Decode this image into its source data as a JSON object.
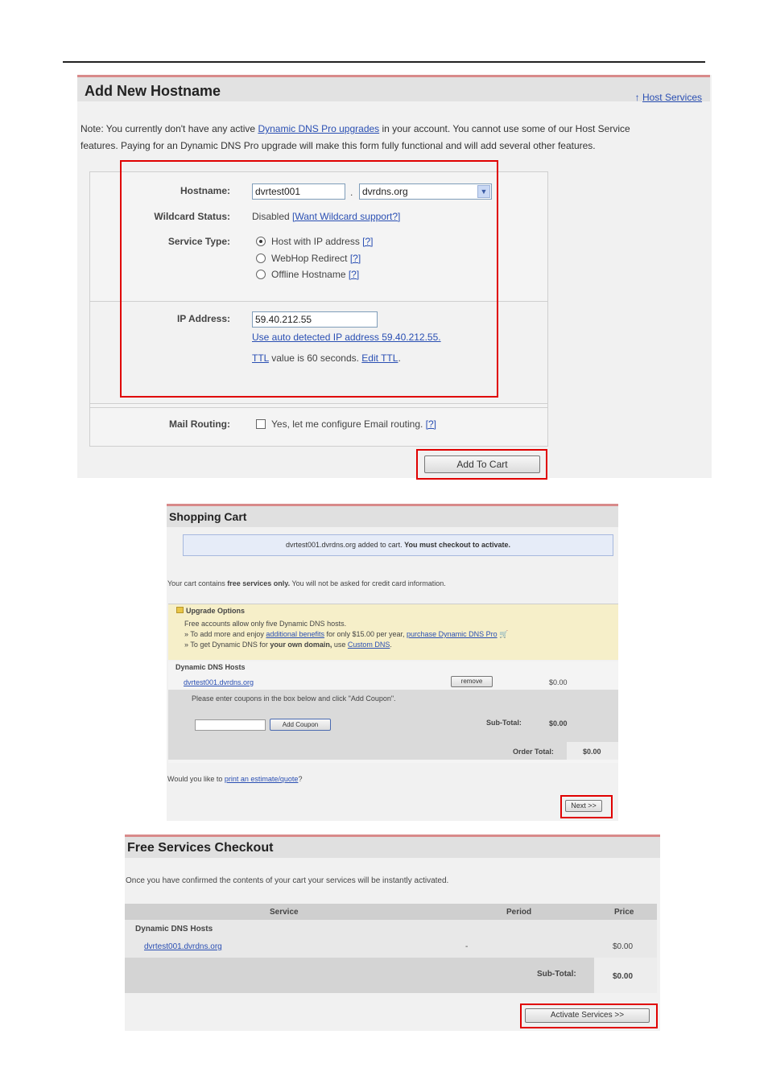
{
  "panel1": {
    "title": "Add New Hostname",
    "host_services_link": "Host Services",
    "note_line1_a": "Note: You currently don't have any active ",
    "note_link": "Dynamic DNS Pro upgrades",
    "note_line1_b": " in your account. You cannot use some of our Host Service",
    "note_line2": "features. Paying for an Dynamic DNS Pro upgrade will make this form fully functional and will add several other features.",
    "hostname_label": "Hostname:",
    "hostname_value": "dvrtest001",
    "dot": ".",
    "domain_value": "dvrdns.org",
    "wildcard_label": "Wildcard Status:",
    "wildcard_value": "Disabled",
    "wildcard_link": "[Want Wildcard support?]",
    "service_type_label": "Service Type:",
    "service_options": [
      {
        "label": "Host with IP address",
        "help": "[?]",
        "selected": true
      },
      {
        "label": "WebHop Redirect",
        "help": "[?]",
        "selected": false
      },
      {
        "label": "Offline Hostname",
        "help": "[?]",
        "selected": false
      }
    ],
    "ip_label": "IP Address:",
    "ip_value": "59.40.212.55",
    "auto_ip_link": "Use auto detected IP address 59.40.212.55.",
    "ttl_link": "TTL",
    "ttl_text": " value is 60 seconds. ",
    "edit_ttl_link": "Edit TTL",
    "ttl_end": ".",
    "mail_label": "Mail Routing:",
    "mail_text": "Yes, let me configure Email routing.",
    "mail_help": "[?]",
    "add_to_cart": "Add To Cart"
  },
  "panel2": {
    "title": "Shopping Cart",
    "notice_a": "dvrtest001.dvrdns.org added to cart. ",
    "notice_b": "You must checkout to activate.",
    "free_a": "Your cart contains ",
    "free_b": "free services only.",
    "free_c": " You will not be asked for credit card information.",
    "upgrade_title": "Upgrade Options",
    "upgrade_line1": "Free accounts allow only five Dynamic DNS hosts.",
    "upgrade_line2_a": "&raquo; To add more and enjoy ",
    "upgrade_line2_link": "additional benefits",
    "upgrade_line2_b": " for only $15.00 per year, ",
    "upgrade_line2_link2": "purchase Dynamic DNS Pro",
    "upgrade_line3_a": "&raquo; To get Dynamic DNS for ",
    "upgrade_line3_b": "your own domain,",
    "upgrade_line3_c": " use ",
    "upgrade_line3_link": "Custom DNS",
    "ddns_header": "Dynamic DNS Hosts",
    "host_link": "dvrtest001.dvrdns.org",
    "remove": "remove",
    "host_price": "$0.00",
    "coupon_text": "Please enter coupons in the box below and click \"Add Coupon\".",
    "add_coupon": "Add Coupon",
    "subtotal_label": "Sub-Total:",
    "subtotal_value": "$0.00",
    "order_total_label": "Order Total:",
    "order_total_value": "$0.00",
    "quote_a": "Would you like to ",
    "quote_link": "print an estimate/quote",
    "quote_b": "?",
    "next": "Next >>"
  },
  "panel3": {
    "title": "Free Services Checkout",
    "desc": "Once you have confirmed the contents of your cart your services will be instantly activated.",
    "col_service": "Service",
    "col_period": "Period",
    "col_price": "Price",
    "group": "Dynamic DNS Hosts",
    "host_link": "dvrtest001.dvrdns.org",
    "period": "-",
    "price": "$0.00",
    "subtotal_label": "Sub-Total:",
    "subtotal_value": "$0.00",
    "activate": "Activate Services >>"
  },
  "colors": {
    "highlight": "#e00000",
    "link": "#2a4fb3",
    "header_accent": "#d88a8a"
  }
}
